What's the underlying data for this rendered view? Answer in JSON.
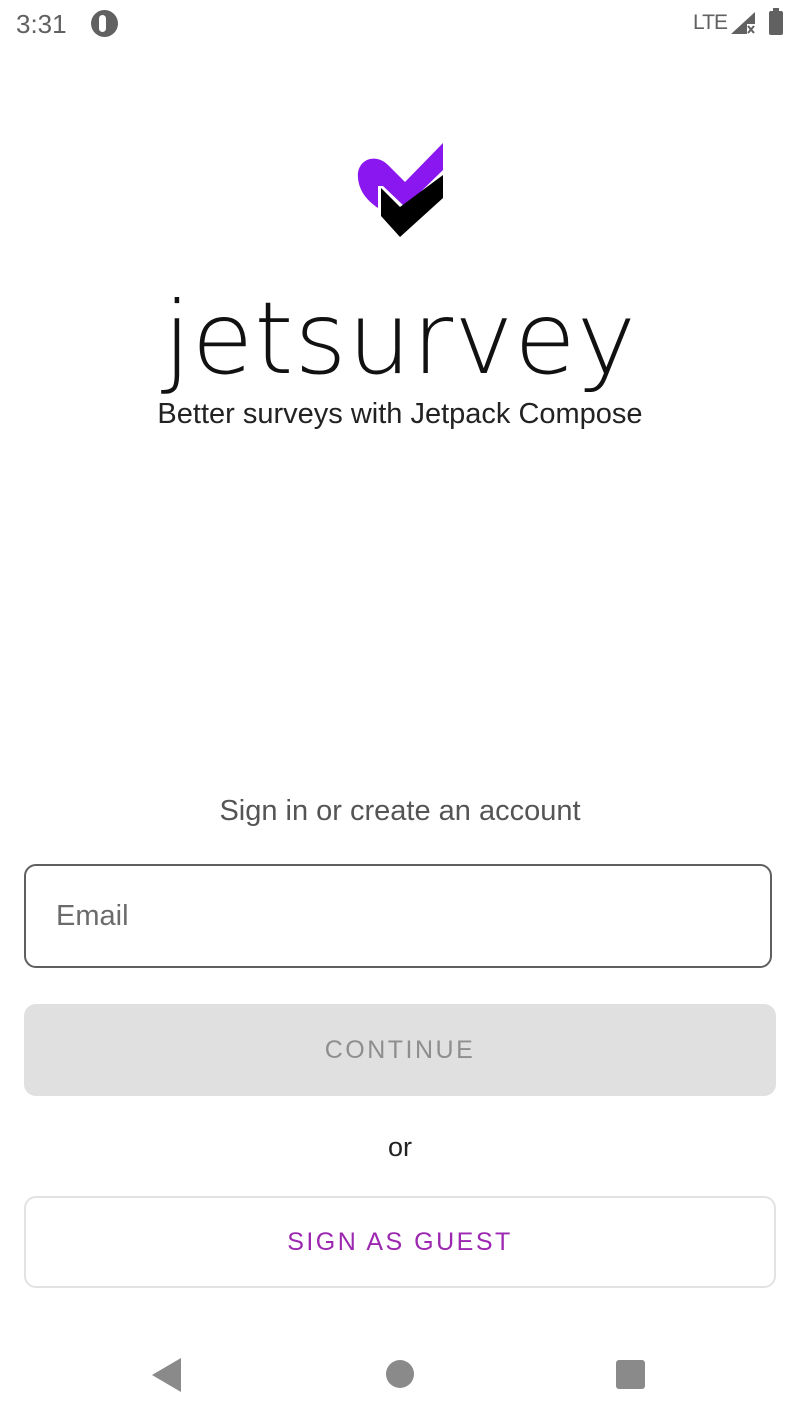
{
  "status_bar": {
    "time": "3:31",
    "network": "LTE",
    "notification_icon": "app-notification-icon",
    "signal_icon": "signal-no-data-icon",
    "battery_icon": "battery-full-icon"
  },
  "brand": {
    "name": "jetsurvey",
    "tagline": "Better surveys with Jetpack Compose",
    "logo_colors": {
      "primary": "#8B17F0",
      "secondary": "#000000"
    }
  },
  "form": {
    "heading": "Sign in or create an account",
    "email": {
      "placeholder": "Email",
      "value": ""
    },
    "continue_label": "CONTINUE",
    "or_label": "or",
    "guest_label": "SIGN AS GUEST"
  },
  "colors": {
    "accent": "#9C27B0",
    "disabled_bg": "#E0E0E0"
  },
  "nav_bar": {
    "back_icon": "back-triangle-icon",
    "home_icon": "home-circle-icon",
    "recents_icon": "recents-square-icon"
  }
}
